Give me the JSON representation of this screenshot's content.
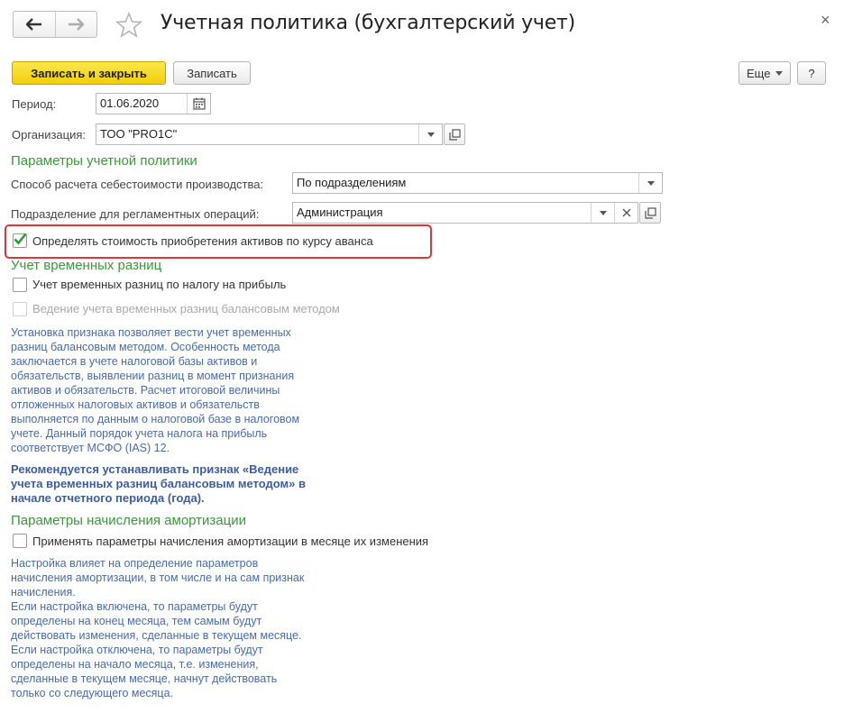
{
  "window": {
    "title": "Учетная политика (бухгалтерский учет)",
    "close_glyph": "×"
  },
  "toolbar": {
    "save_close_label": "Записать и закрыть",
    "save_label": "Записать",
    "more_label": "Еще",
    "help_label": "?"
  },
  "form": {
    "period_label": "Период:",
    "period_value": "01.06.2020",
    "organization_label": "Организация:",
    "organization_value": "ТОО \"PRO1C\""
  },
  "policy_section": {
    "title": "Параметры учетной политики",
    "cost_method_label": "Способ расчета себестоимости производства:",
    "cost_method_value": "По подразделениям",
    "division_label": "Подразделение для регламентных операций:",
    "division_value": "Администрация",
    "advance_rate_label": "Определять стоимость приобретения активов по курсу аванса",
    "advance_rate_checked": true
  },
  "temp_diff_section": {
    "title": "Учет временных разниц",
    "profit_tax_label": "Учет временных разниц по налогу на прибыль",
    "profit_tax_checked": false,
    "balance_method_label": "Ведение учета временных разниц балансовым методом",
    "balance_method_checked": false,
    "description": "Установка признака позволяет вести учет временных\nразниц балансовым методом.  Особенность метода\nзаключается в учете налоговой базы активов и\nобязательств, выявлении разниц  в момент признания\nактивов и обязательств. Расчет итоговой величины\nотложенных налоговых активов и обязательств\nвыполняется по данным о налоговой базе в налоговом\nучете. Данный порядок учета налога на прибыль\nсоответствует МСФО (IAS)  12.",
    "recommendation": "Рекомендуется устанавливать признак «Ведение\nучета временных разниц балансовым методом» в\nначале отчетного периода (года)."
  },
  "depreciation_section": {
    "title": "Параметры начисления амортизации",
    "apply_label": "Применять параметры начисления амортизации в месяце их изменения",
    "apply_checked": false,
    "description": "Настройка влияет на определение параметров\nначисления амортизации, в том числе и на сам признак\nначисления.\nЕсли настройка включена, то параметры будут\nопределены на конец месяца, тем самым будут\nдействовать изменения, сделанные в текущем месяце.\nЕсли настройка отключена, то параметры будут\nопределены на начало месяца, т.е. изменения,\nсделанные в текущем месяце, начнут действовать\nтолько со следующего месяца."
  },
  "colors": {
    "section_green": "#3a9a3a",
    "note_blue": "#4b6aa8",
    "primary_yellow": "#f5d41a",
    "highlight_red": "#e3343a",
    "check_green": "#2e9a35"
  },
  "icons": [
    "back-arrow-icon",
    "forward-arrow-icon",
    "favorite-star-icon",
    "close-icon",
    "calendar-icon",
    "dropdown-icon",
    "open-form-icon",
    "clear-icon",
    "checkmark-icon"
  ]
}
